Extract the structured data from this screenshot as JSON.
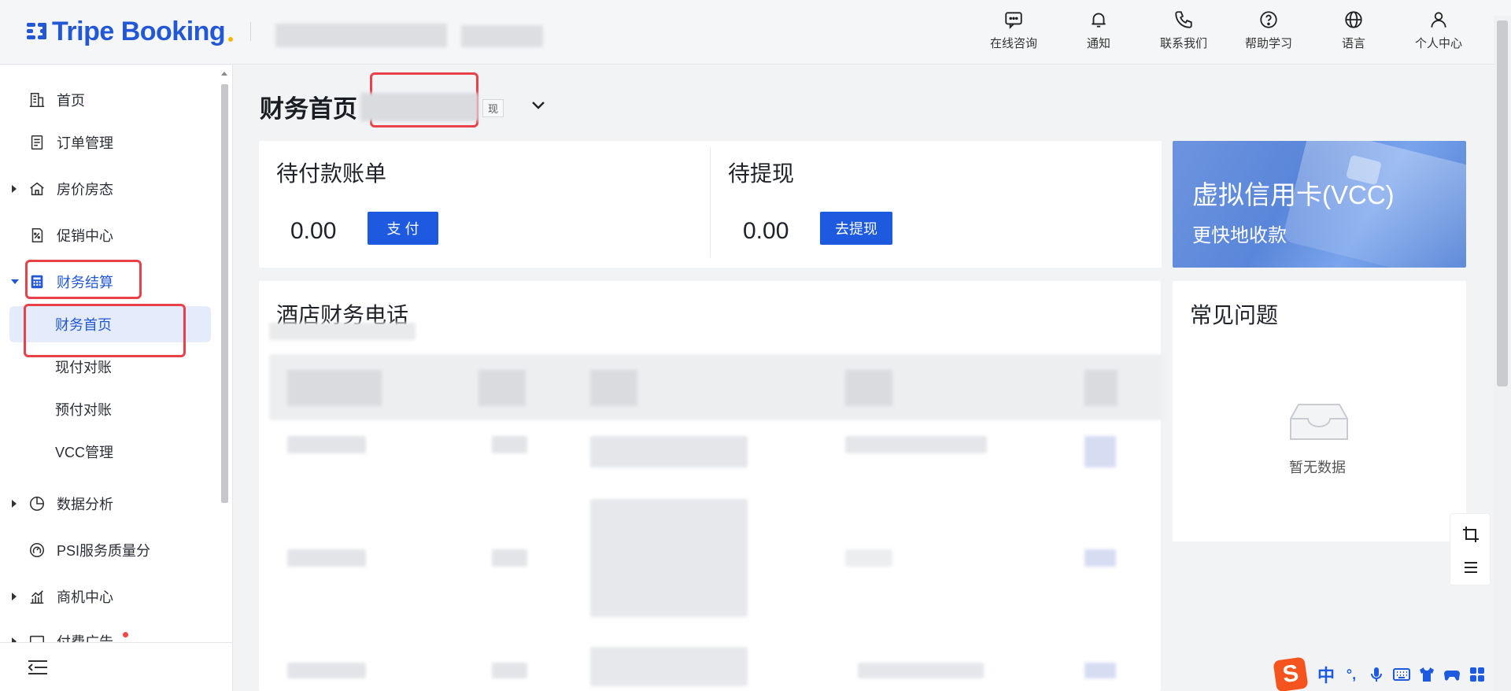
{
  "header": {
    "logo_text": "Tripe Booking",
    "nav": [
      {
        "label": "在线咨询",
        "icon": "chat-icon"
      },
      {
        "label": "通知",
        "icon": "bell-icon"
      },
      {
        "label": "联系我们",
        "icon": "phone-icon"
      },
      {
        "label": "帮助学习",
        "icon": "help-icon"
      },
      {
        "label": "语言",
        "icon": "globe-icon"
      },
      {
        "label": "个人中心",
        "icon": "user-icon"
      }
    ]
  },
  "sidebar": {
    "items": [
      {
        "label": "首页",
        "icon": "building-icon"
      },
      {
        "label": "订单管理",
        "icon": "document-icon"
      },
      {
        "label": "房价房态",
        "icon": "home-icon"
      },
      {
        "label": "促销中心",
        "icon": "discount-icon"
      },
      {
        "label": "财务结算",
        "icon": "calculator-icon"
      },
      {
        "label": "数据分析",
        "icon": "pie-chart-icon"
      },
      {
        "label": "PSI服务质量分",
        "icon": "gauge-icon"
      },
      {
        "label": "商机中心",
        "icon": "bar-chart-icon"
      },
      {
        "label": "付费广告",
        "icon": "ad-icon"
      }
    ],
    "finance_sub": [
      {
        "label": "财务首页"
      },
      {
        "label": "现付对账"
      },
      {
        "label": "预付对账"
      },
      {
        "label": "VCC管理"
      }
    ]
  },
  "main": {
    "page_title": "财务首页",
    "hotel_tag": "现",
    "pending_pay": {
      "title": "待付款账单",
      "amount": "0.00",
      "button": "支 付"
    },
    "pending_withdraw": {
      "title": "待提现",
      "amount": "0.00",
      "button": "去提现"
    },
    "vcc": {
      "title": "虚拟信用卡(VCC)",
      "subtitle": "更快地收款"
    },
    "finance_phone": {
      "title": "酒店财务电话"
    },
    "faq": {
      "title": "常见问题",
      "empty": "暂无数据"
    }
  },
  "ime": {
    "lang": "中",
    "punct": "°,"
  },
  "colors": {
    "primary": "#1d5ae0",
    "highlight": "#e8414a",
    "brand": "#2257d6"
  }
}
